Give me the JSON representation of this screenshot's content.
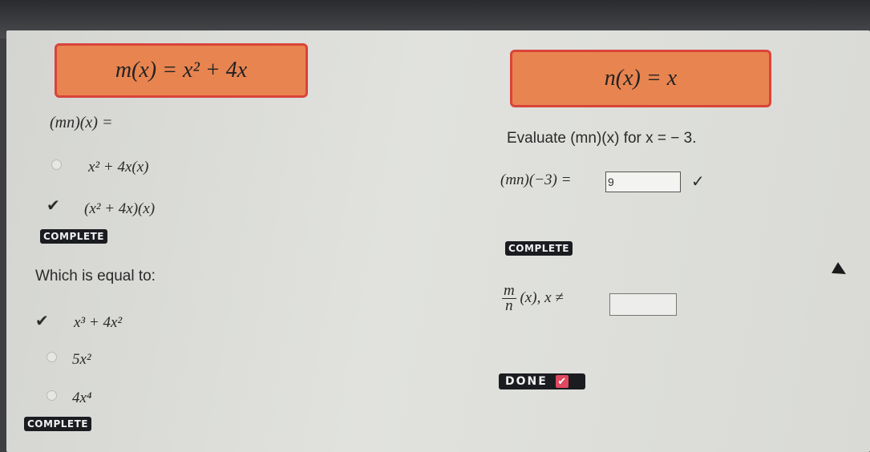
{
  "left": {
    "function_m": "m(x) = x² + 4x",
    "question1": "(mn)(x) =",
    "q1_options": [
      {
        "label": "x² + 4x(x)",
        "selected": false
      },
      {
        "label": "(x² + 4x)(x)",
        "selected": true
      }
    ],
    "q1_status": "COMPLETE",
    "question2": "Which is equal to:",
    "q2_options": [
      {
        "label": "x³ + 4x²",
        "selected": true
      },
      {
        "label": "5x²",
        "selected": false
      },
      {
        "label": "4x⁴",
        "selected": false
      }
    ],
    "q2_status": "COMPLETE"
  },
  "right": {
    "function_n": "n(x) = x",
    "evaluate_text": "Evaluate (mn)(x) for x = − 3.",
    "eval_expr": "(mn)(−3) =",
    "eval_answer": "9",
    "eval_status": "COMPLETE",
    "quotient_num": "m",
    "quotient_den": "n",
    "quotient_rest": "(x),  x ≠",
    "quotient_answer": "",
    "done_label": "DONE"
  },
  "icons": {
    "checkmark": "check-icon",
    "done_check": "check-icon",
    "cursor": "mouse-pointer-icon"
  },
  "colors": {
    "function_box_fill": "#e88450",
    "function_box_border": "#d9443a",
    "badge_bg": "#1b1c20",
    "done_check_bg": "#e0485f"
  }
}
